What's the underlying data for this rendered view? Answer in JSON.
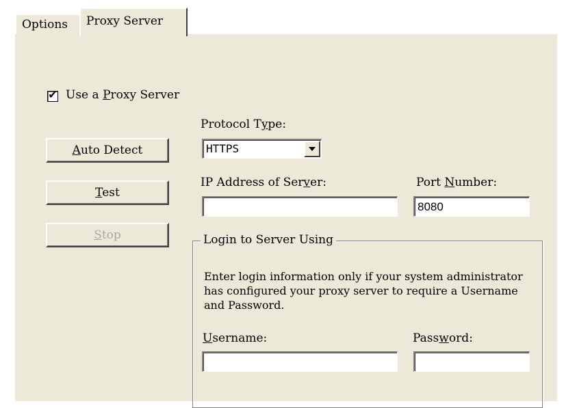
{
  "tabs": [
    {
      "label": "Options"
    },
    {
      "label": "Proxy Server"
    }
  ],
  "use_proxy": {
    "label_pre": "Use a ",
    "label_key": "P",
    "label_post": "roxy Server",
    "checked_glyph": "✔"
  },
  "buttons": {
    "auto_detect": {
      "key": "A",
      "rest": "uto Detect"
    },
    "test": {
      "key": "T",
      "rest": "est"
    },
    "stop": {
      "key": "S",
      "rest": "top"
    }
  },
  "protocol": {
    "label_pre": "Protocol T",
    "label_key": "y",
    "label_post": "pe:",
    "value": "HTTPS"
  },
  "ip": {
    "label_pre": "IP Address of Ser",
    "label_key": "v",
    "label_post": "er:",
    "value": ""
  },
  "port": {
    "label_pre": "Port ",
    "label_key": "N",
    "label_post": "umber:",
    "value": "8080"
  },
  "login": {
    "legend": "Login to Server Using",
    "note": "Enter login information only if your system administrator has configured your proxy server to require a Username and Password.",
    "username": {
      "label_key": "U",
      "label_post": "sername:",
      "value": ""
    },
    "password": {
      "label_pre": "Pass",
      "label_key": "w",
      "label_post": "ord:",
      "value": ""
    }
  }
}
